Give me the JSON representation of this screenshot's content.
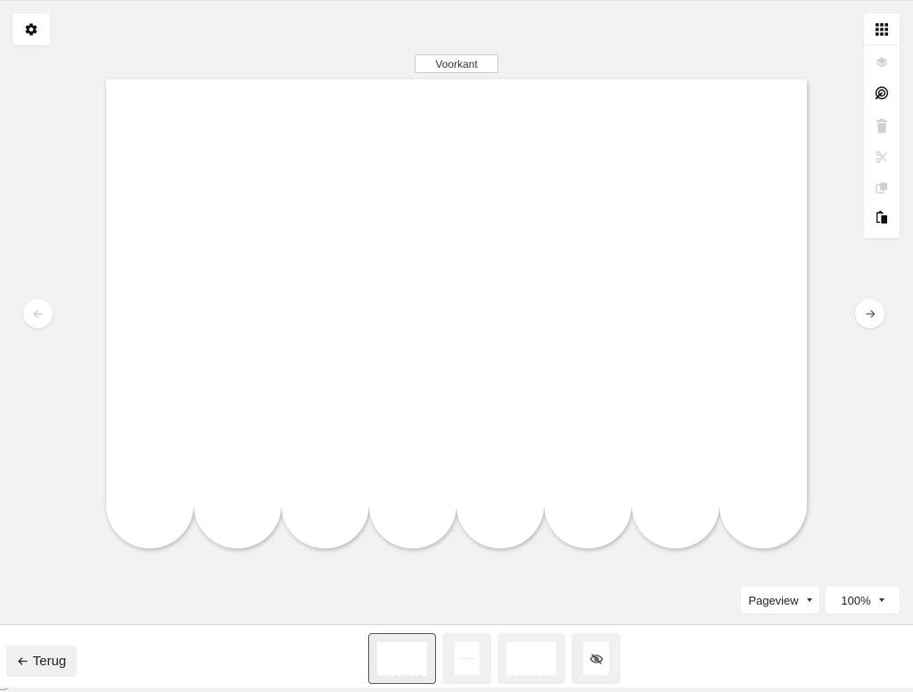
{
  "canvas": {
    "side_label": "Voorkant",
    "scallop_count": 8,
    "card_color": "#ffffff"
  },
  "settings": {
    "icon": "gear-icon"
  },
  "navigation": {
    "prev_icon": "arrow-left-icon",
    "next_icon": "arrow-right-icon"
  },
  "toolbar": {
    "tools": [
      {
        "name": "grid-icon",
        "enabled": true
      },
      {
        "name": "layers-icon",
        "enabled": false
      },
      {
        "name": "target-icon",
        "enabled": true
      },
      {
        "name": "trash-icon",
        "enabled": false
      },
      {
        "name": "scissors-icon",
        "enabled": false
      },
      {
        "name": "copy-icon",
        "enabled": false
      },
      {
        "name": "paste-icon",
        "enabled": true
      }
    ]
  },
  "view_controls": {
    "pageview_label": "Pageview",
    "zoom_label": "100%"
  },
  "footer": {
    "back_label": "Terug",
    "pages": [
      {
        "type": "scallop-card",
        "active": true
      },
      {
        "type": "plain-card",
        "active": false
      },
      {
        "type": "scallop-card",
        "active": false
      },
      {
        "type": "hidden",
        "active": false,
        "icon": "eye-off-icon"
      }
    ]
  },
  "colors": {
    "background": "#f2f2f2",
    "panel": "#ffffff",
    "icon_active": "#111111",
    "icon_disabled": "#cccccc"
  }
}
